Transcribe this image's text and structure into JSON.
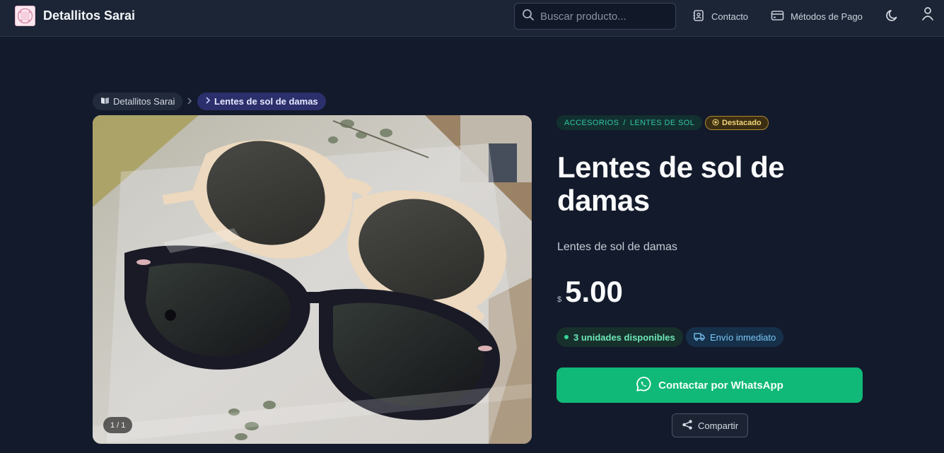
{
  "header": {
    "brand": "Detallitos Sarai",
    "search_placeholder": "Buscar producto...",
    "nav": {
      "contact": "Contacto",
      "payment": "Métodos de Pago"
    }
  },
  "breadcrumb": {
    "home": "Detallitos Sarai",
    "current": "Lentes de sol de damas"
  },
  "gallery": {
    "counter": "1 / 1"
  },
  "product": {
    "category": "ACCESORIOS",
    "separator": "/",
    "subcategory": "LENTES DE SOL",
    "featured": "Destacado",
    "title": "Lentes de sol de damas",
    "description": "Lentes de sol de damas",
    "currency": "$",
    "price": "5.00",
    "stock": "3 unidades disponibles",
    "shipping": "Envío inmediato",
    "whatsapp_label": "Contactar por WhatsApp",
    "share_label": "Compartir"
  },
  "colors": {
    "accent_green": "#10b978",
    "teal": "#33c3a6",
    "gold": "#f2d47a",
    "indigo": "#2b2f6b"
  }
}
